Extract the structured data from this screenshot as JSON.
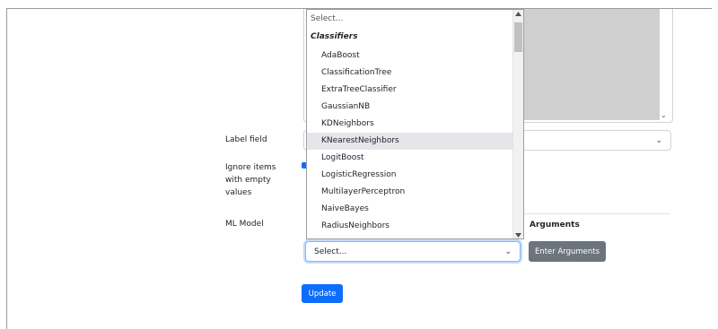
{
  "form": {
    "label_field_label": "Label field",
    "ignore_items_label_line1": "Ignore items",
    "ignore_items_label_line2": "with empty",
    "ignore_items_label_line3": "values",
    "ml_model_label": "ML Model",
    "arguments_heading": "Arguments",
    "ml_model_select_value": "Select...",
    "enter_arguments_button": "Enter Arguments",
    "update_button": "Update",
    "chevron_glyph": "⌄"
  },
  "dropdown": {
    "placeholder": "Select...",
    "group_label": "Classifiers",
    "highlighted_item": "KNearestNeighbors",
    "items": [
      "AdaBoost",
      "ClassificationTree",
      "ExtraTreeClassifier",
      "GaussianNB",
      "KDNeighbors",
      "KNearestNeighbors",
      "LogitBoost",
      "LogisticRegression",
      "MultilayerPerceptron",
      "NaiveBayes",
      "RadiusNeighbors"
    ]
  },
  "colors": {
    "primary": "#0d6efd",
    "secondary": "#6c757d",
    "highlight": "#e5e5ea",
    "gray_panel": "#cfcfcf"
  },
  "icons": [
    "chevron-down-icon",
    "scroll-up-arrow-icon",
    "scroll-down-arrow-icon",
    "checkbox-checked-icon"
  ]
}
